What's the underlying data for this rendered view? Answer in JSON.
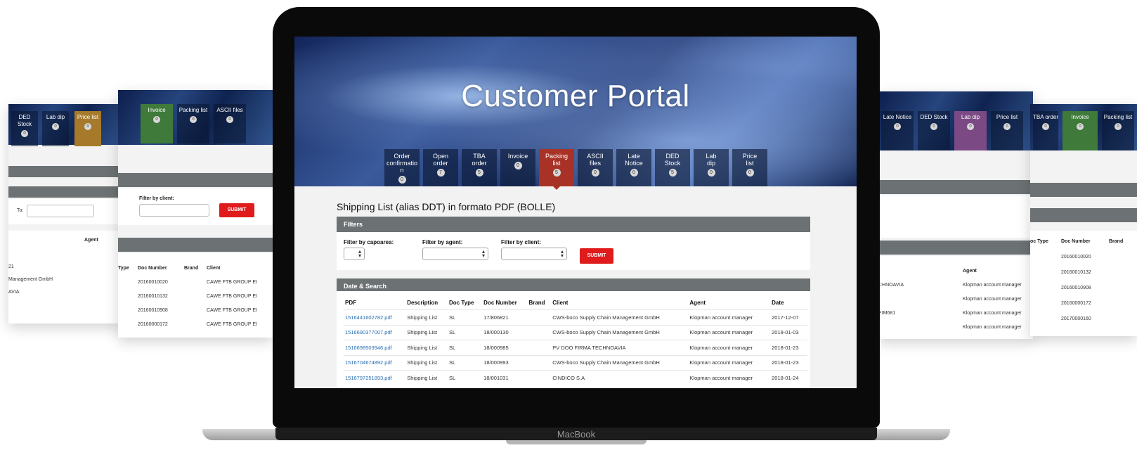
{
  "laptop": {
    "brand": "MacBook"
  },
  "portal": {
    "title": "Customer Portal",
    "tabs": [
      {
        "label": [
          "Order",
          "confirmatio",
          "n"
        ],
        "count": "0",
        "active": false
      },
      {
        "label": [
          "Open",
          "order"
        ],
        "count": "7",
        "active": false
      },
      {
        "label": [
          "TBA",
          "order"
        ],
        "count": "5",
        "active": false
      },
      {
        "label": [
          "Invoice"
        ],
        "count": "0",
        "active": false
      },
      {
        "label": [
          "Packing",
          "list"
        ],
        "count": "5",
        "active": true
      },
      {
        "label": [
          "ASCII",
          "files"
        ],
        "count": "0",
        "active": false
      },
      {
        "label": [
          "Late",
          "Notice"
        ],
        "count": "0",
        "active": false
      },
      {
        "label": [
          "DED",
          "Stock"
        ],
        "count": "5",
        "active": false
      },
      {
        "label": [
          "Lab",
          "dip"
        ],
        "count": "0",
        "active": false
      },
      {
        "label": [
          "Price",
          "list"
        ],
        "count": "0",
        "active": false
      }
    ],
    "page_title": "Shipping List (alias DDT) in formato PDF (BOLLE)",
    "filters_heading": "Filters",
    "filter_capoarea_label": "Filter by capoarea:",
    "filter_agent_label": "Filter by agent:",
    "filter_client_label": "Filter by client:",
    "submit_label": "SUBMIT",
    "search_heading": "Date & Search",
    "columns": [
      "PDF",
      "Description",
      "Doc Type",
      "Doc Number",
      "Brand",
      "Client",
      "Agent",
      "Date"
    ],
    "rows": [
      [
        "1516441602782.pdf",
        "Shipping List",
        "SL",
        "17/806821",
        "",
        "CWS-boco Supply Chain Management GmbH",
        "Klopman account manager",
        "2017-12-07"
      ],
      [
        "1516690377007.pdf",
        "Shipping List",
        "SL",
        "18/000130",
        "",
        "CWS-boco Supply Chain Management GmbH",
        "Klopman account manager",
        "2018-01-03"
      ],
      [
        "1516698503946.pdf",
        "Shipping List",
        "SL",
        "18/000985",
        "",
        "PV DOO FIRMA TECHNOAVIA",
        "Klopman account manager",
        "2018-01-23"
      ],
      [
        "1516704674892.pdf",
        "Shipping List",
        "SL",
        "18/000993",
        "",
        "CWS-boco Supply Chain Management GmbH",
        "Klopman account manager",
        "2018-01-23"
      ],
      [
        "1516797251893.pdf",
        "Shipping List",
        "SL",
        "18/001031",
        "",
        "CINDICO S.A",
        "Klopman account manager",
        "2018-01-24"
      ]
    ]
  },
  "panels": {
    "far_left": {
      "tabs": [
        {
          "label": "DED Stock",
          "count": "0"
        },
        {
          "label": "Lab dip",
          "count": "0"
        },
        {
          "label": "Price list",
          "count": "0"
        }
      ],
      "to_label": "To:",
      "agent_header": "Agent",
      "rows": [
        "21",
        "Management GmbH",
        "AVIA"
      ]
    },
    "left": {
      "tabs": [
        {
          "label": "Invoice",
          "count": "0"
        },
        {
          "label": "Packing list",
          "count": "0"
        },
        {
          "label": "ASCII files",
          "count": "0"
        }
      ],
      "filter_label": "Filter by client:",
      "submit_label": "SUBMIT",
      "columns": [
        "Type",
        "Doc Number",
        "Brand",
        "Client"
      ],
      "doc_numbers": [
        "20160010020",
        "20160010132",
        "20160010908",
        "20160000172"
      ],
      "client": "CAWE FTB GROUP EI"
    },
    "right": {
      "tabs": [
        {
          "label": "Late Notice",
          "count": "0"
        },
        {
          "label": "DED Stock",
          "count": "0"
        },
        {
          "label": "Lab dip",
          "count": "0"
        },
        {
          "label": "Price list",
          "count": "0"
        }
      ],
      "agent_header": "Agent",
      "rows": [
        [
          "CHNOAVIA",
          "Klopman account manager"
        ],
        [
          "",
          "Klopman account manager"
        ],
        [
          "EIM681",
          "Klopman account manager"
        ],
        [
          "",
          "Klopman account manager"
        ]
      ]
    },
    "far_right": {
      "tabs": [
        {
          "label": "TBA order",
          "count": "0"
        },
        {
          "label": "Invoice",
          "count": "0"
        },
        {
          "label": "Packing list",
          "count": "0"
        }
      ],
      "columns": [
        "oc Type",
        "Doc Number",
        "Brand"
      ],
      "doc_numbers": [
        "20160010020",
        "20160010132",
        "20160010908",
        "20160000172",
        "20170000160"
      ]
    }
  }
}
